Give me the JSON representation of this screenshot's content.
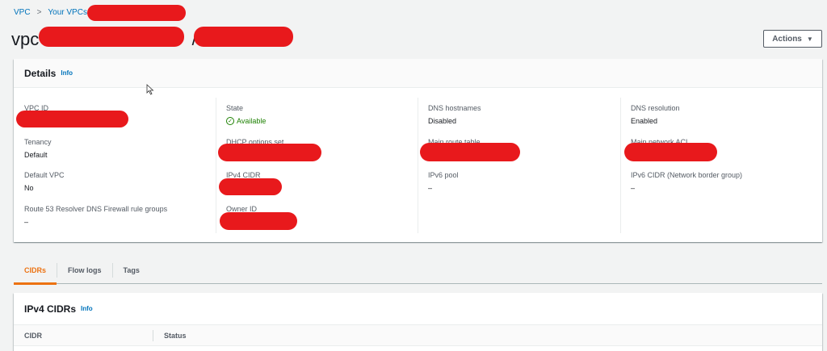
{
  "breadcrumb": {
    "items": [
      "VPC",
      "Your VPCs"
    ],
    "separator": ">"
  },
  "page": {
    "title_prefix": "vpc-",
    "title_separator": "/",
    "actions_label": "Actions"
  },
  "details": {
    "title": "Details",
    "info": "Info",
    "columns": [
      [
        {
          "label": "VPC ID",
          "value": ""
        },
        {
          "label": "Tenancy",
          "value": "Default"
        },
        {
          "label": "Default VPC",
          "value": "No"
        },
        {
          "label": "Route 53 Resolver DNS Firewall rule groups",
          "value": "–"
        }
      ],
      [
        {
          "label": "State",
          "value": "Available"
        },
        {
          "label": "DHCP options set",
          "value": ""
        },
        {
          "label": "IPv4 CIDR",
          "value": ""
        },
        {
          "label": "Owner ID",
          "value": ""
        }
      ],
      [
        {
          "label": "DNS hostnames",
          "value": "Disabled"
        },
        {
          "label": "Main route table",
          "value": ""
        },
        {
          "label": "IPv6 pool",
          "value": "–"
        }
      ],
      [
        {
          "label": "DNS resolution",
          "value": "Enabled"
        },
        {
          "label": "Main network ACL",
          "value": ""
        },
        {
          "label": "IPv6 CIDR (Network border group)",
          "value": "–"
        }
      ]
    ]
  },
  "tabs": [
    {
      "label": "CIDRs",
      "active": true
    },
    {
      "label": "Flow logs",
      "active": false
    },
    {
      "label": "Tags",
      "active": false
    }
  ],
  "cidrs": {
    "title": "IPv4 CIDRs",
    "info": "Info",
    "columns": [
      "CIDR",
      "Status"
    ]
  },
  "colors": {
    "link": "#0073bb",
    "success": "#1d8102",
    "active_tab": "#ec7211",
    "redaction": "#e8191c"
  }
}
